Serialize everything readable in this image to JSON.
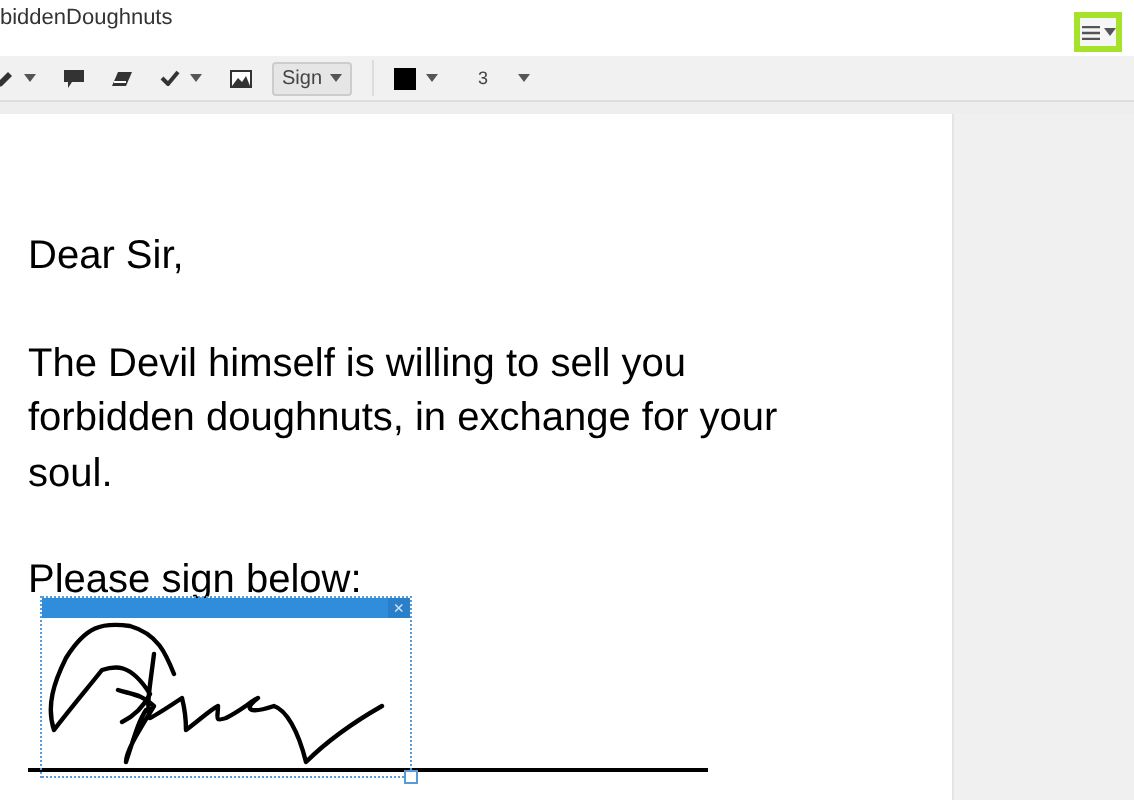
{
  "window": {
    "title": "biddenDoughnuts"
  },
  "menu_button": {
    "highlighted": true
  },
  "toolbar": {
    "tools": [
      {
        "kind": "pen",
        "has_caret": true
      },
      {
        "kind": "comment",
        "has_caret": false
      },
      {
        "kind": "eraser",
        "has_caret": false
      },
      {
        "kind": "check",
        "has_caret": true
      },
      {
        "kind": "image",
        "has_caret": false
      }
    ],
    "sign_button": {
      "label": "Sign"
    },
    "pen_color": {
      "color": "#000000"
    },
    "line_width": {
      "value": "3"
    }
  },
  "document": {
    "paragraphs": [
      "Dear Sir,",
      "The Devil himself is willing to sell you forbidden doughnuts, in exchange for your soul.",
      "Please sign below:"
    ]
  },
  "signature_box": {
    "close": "×"
  }
}
